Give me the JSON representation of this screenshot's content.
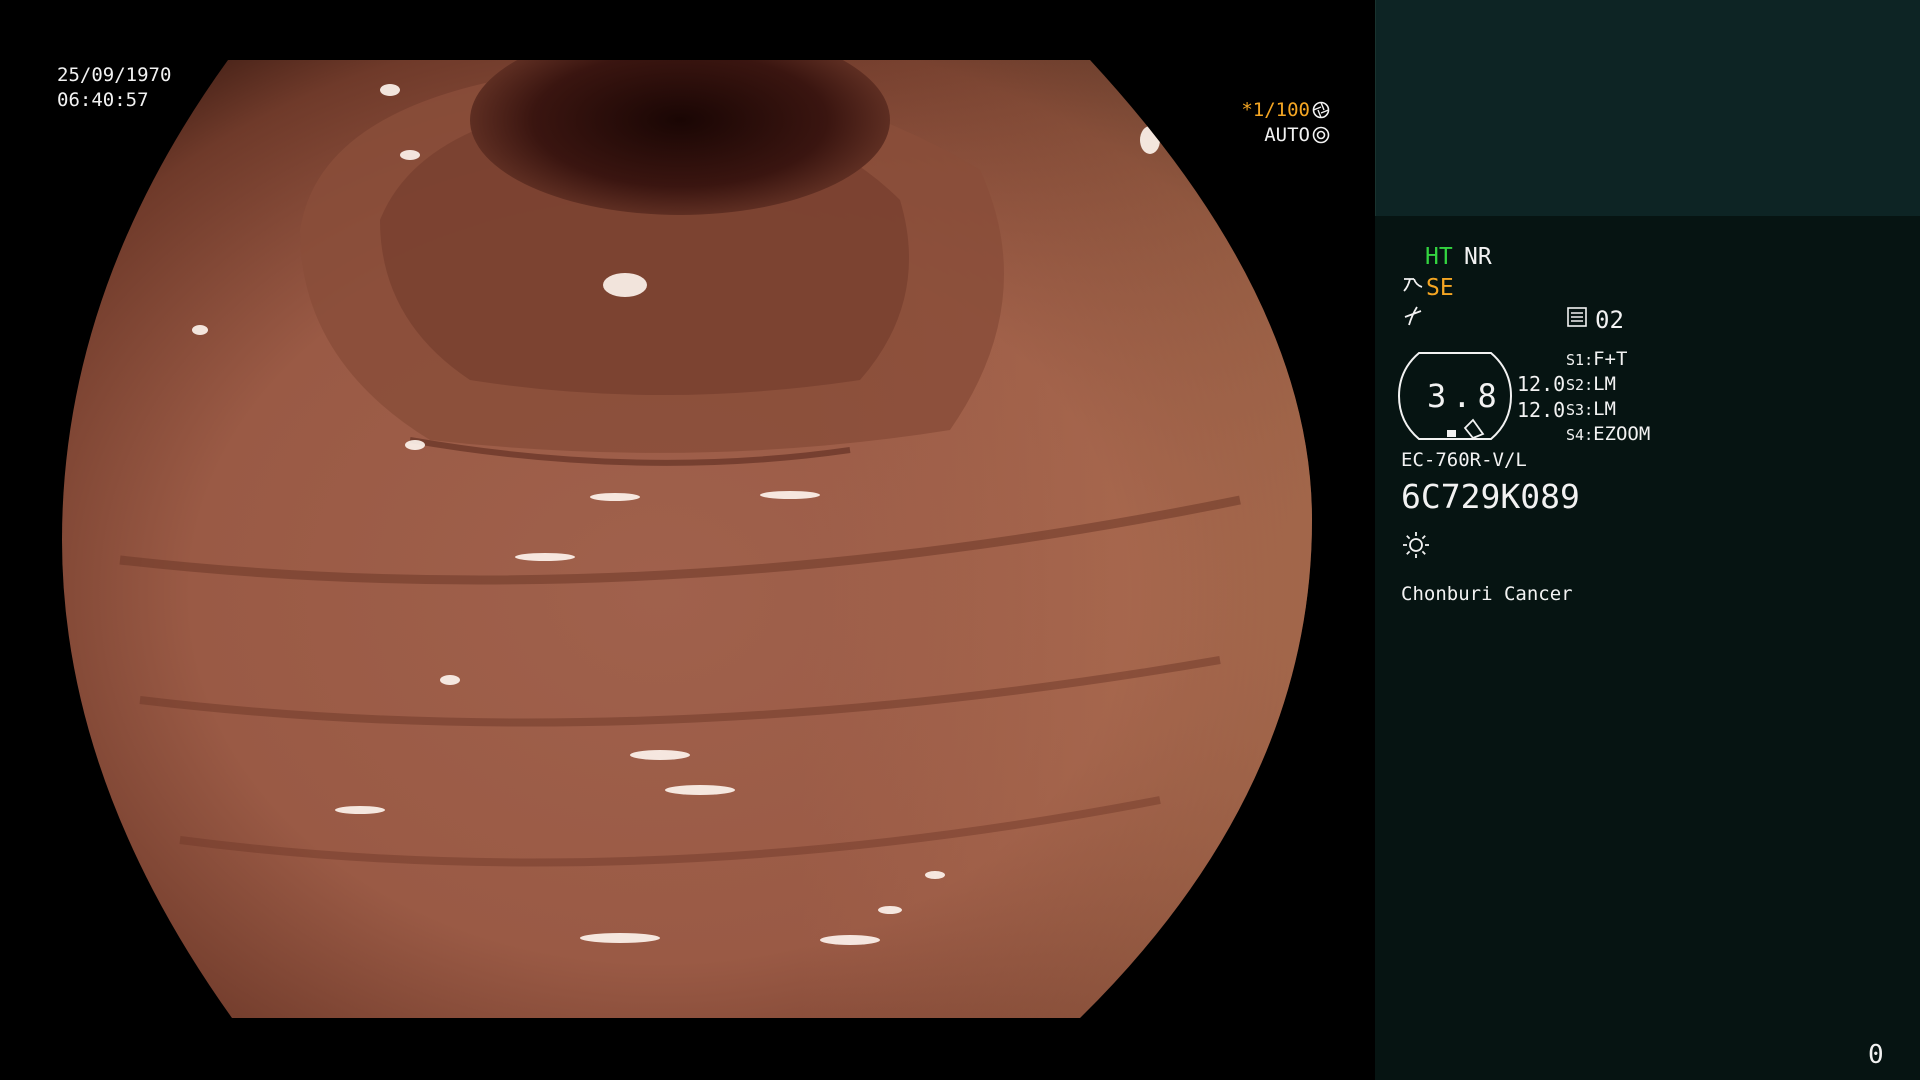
{
  "overlay": {
    "date": "25/09/1970",
    "time": "06:40:57",
    "shutter": "*1/100",
    "iris_mode": "AUTO"
  },
  "panel": {
    "ht_label": "HT",
    "nr_label": "NR",
    "se_label": "SE",
    "memory_value": "02",
    "dial_value": "3.8",
    "value_upper": "12.0",
    "value_lower": "12.0",
    "switches": [
      {
        "key": "S1",
        "value": "F+T"
      },
      {
        "key": "S2",
        "value": "LM"
      },
      {
        "key": "S3",
        "value": "LM"
      },
      {
        "key": "S4",
        "value": "EZOOM"
      }
    ],
    "scope_model": "EC-760R-V/L",
    "scope_serial": "6C729K089",
    "hospital": "Chonburi Cancer",
    "counter": "0"
  },
  "icons": {
    "shutter": "aperture-icon",
    "iris": "iris-icon",
    "se": "structure-enhance-icon",
    "curve": "curve-icon",
    "memory": "memory-card-icon",
    "light": "sun-icon"
  },
  "colors": {
    "ht": "#33d440",
    "se": "#f5a623",
    "shutter": "#f5a623",
    "panel_bg": "#061412",
    "panel_top": "#0d2424"
  }
}
